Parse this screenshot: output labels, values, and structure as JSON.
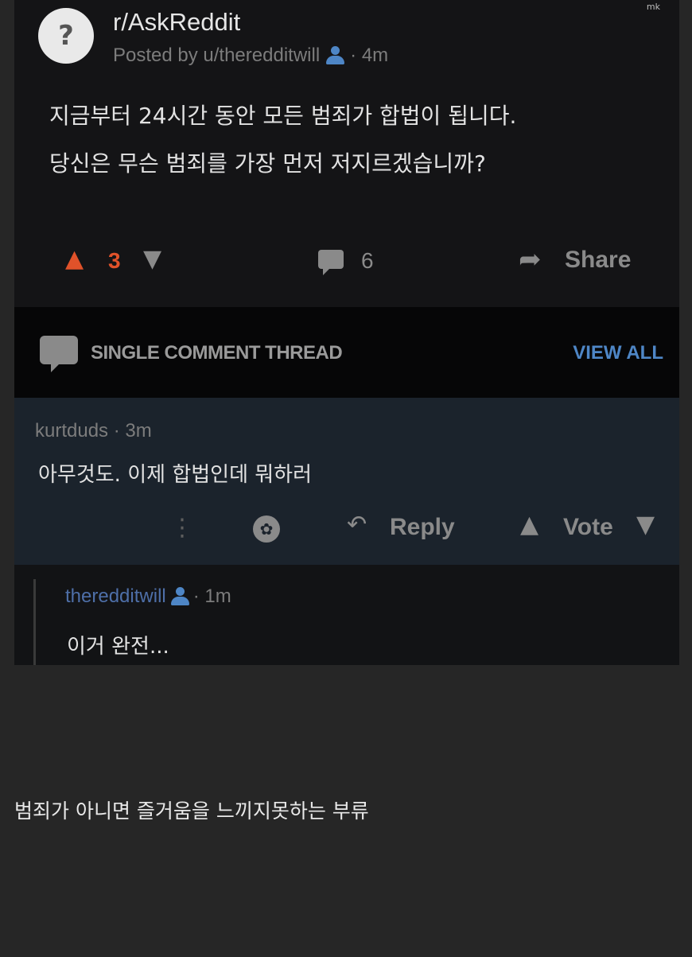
{
  "watermark": "mk",
  "post": {
    "subreddit": "r/AskReddit",
    "posted_by": "Posted by u/theredditwill",
    "time": "· 4m",
    "body_lines": [
      "지금부터 24시간 동안 모든 범죄가 합법이 됩니다.",
      "당신은 무슨 범죄를 가장 먼저 저지르겠습니까?"
    ],
    "score": "3",
    "comment_count": "6",
    "share_label": "Share"
  },
  "thread_bar": {
    "title": "SINGLE COMMENT THREAD",
    "view_all": "VIEW ALL"
  },
  "comment1": {
    "meta": "kurtduds · 3m",
    "text": "아무것도. 이제 합법인데 뭐하러",
    "reply_label": "Reply",
    "vote_label": "Vote"
  },
  "comment2": {
    "author": "theredditwill",
    "time": "· 1m",
    "text": "이거 완전..."
  },
  "caption": "범죄가 아니면 즐거움을 느끼지못하는 부류",
  "colors": {
    "upvote": "#e0522a",
    "link_blue": "#4e86c6",
    "post_bg": "#141416",
    "comment_bg": "#1b232c",
    "page_bg": "#262626"
  },
  "icons": [
    "avatar-icon",
    "user-icon",
    "upvote-icon",
    "downvote-icon",
    "comment-icon",
    "share-icon",
    "chat-icon",
    "more-icon",
    "gild-icon",
    "reply-icon"
  ]
}
